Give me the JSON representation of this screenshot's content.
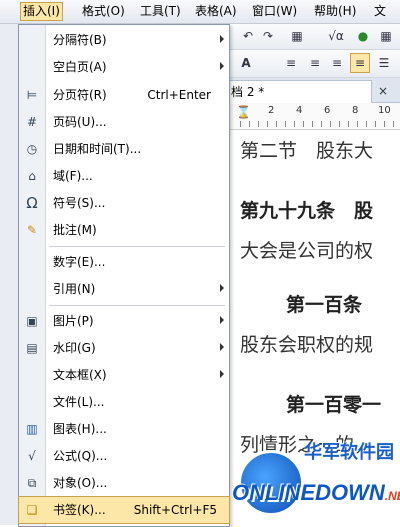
{
  "menubar": {
    "items": [
      {
        "label": "插入(I)",
        "active": true
      },
      {
        "label": "格式(O)"
      },
      {
        "label": "工具(T)"
      },
      {
        "label": "表格(A)"
      },
      {
        "label": "窗口(W)"
      },
      {
        "label": "帮助(H)"
      },
      {
        "label": "文"
      }
    ]
  },
  "toolbar": {
    "undo": "↶",
    "redo": "↷",
    "table": "▦",
    "formula": "√α",
    "font_grow": "A",
    "align_left": "≡",
    "align_center": "≡",
    "align_right": "≡",
    "justify": "≡"
  },
  "doc_tab": {
    "title": "档 2 *",
    "close": "×"
  },
  "ruler": {
    "ticks": [
      "2",
      "4",
      "6",
      "8",
      "10"
    ]
  },
  "document": {
    "lines": [
      "第二节　股东大",
      "第九十九条　股",
      "大会是公司的权",
      "第一百条",
      "股东会职权的规",
      "第一百零一",
      "列情形之一的，"
    ]
  },
  "menu": {
    "items": [
      {
        "label": "分隔符(B)",
        "icon": "",
        "icon_name": "none",
        "shortcut": "",
        "submenu": true
      },
      {
        "label": "空白页(A)",
        "icon": "",
        "icon_name": "none",
        "shortcut": "",
        "submenu": true
      },
      {
        "label": "分页符(R)",
        "icon": "⊨",
        "icon_name": "page-break-icon",
        "shortcut": "Ctrl+Enter",
        "submenu": false
      },
      {
        "label": "页码(U)...",
        "icon": "#",
        "icon_name": "page-number-icon",
        "shortcut": "",
        "submenu": false
      },
      {
        "label": "日期和时间(T)...",
        "icon": "◷",
        "icon_name": "date-time-icon",
        "shortcut": "",
        "submenu": false
      },
      {
        "label": "域(F)...",
        "icon": "⌂",
        "icon_name": "field-icon",
        "shortcut": "",
        "submenu": false
      },
      {
        "label": "符号(S)...",
        "icon": "Ω",
        "icon_name": "omega-symbol-icon",
        "shortcut": "",
        "submenu": false
      },
      {
        "label": "批注(M)",
        "icon": "✎",
        "icon_name": "comment-icon",
        "shortcut": "",
        "submenu": false
      },
      {
        "label": "数字(E)...",
        "icon": "",
        "icon_name": "none",
        "shortcut": "",
        "submenu": false
      },
      {
        "label": "引用(N)",
        "icon": "",
        "icon_name": "none",
        "shortcut": "",
        "submenu": true
      },
      {
        "label": "图片(P)",
        "icon": "▣",
        "icon_name": "picture-icon",
        "shortcut": "",
        "submenu": true
      },
      {
        "label": "水印(G)",
        "icon": "▤",
        "icon_name": "watermark-icon",
        "shortcut": "",
        "submenu": true
      },
      {
        "label": "文本框(X)",
        "icon": "",
        "icon_name": "none",
        "shortcut": "",
        "submenu": true
      },
      {
        "label": "文件(L)...",
        "icon": "",
        "icon_name": "none",
        "shortcut": "",
        "submenu": false
      },
      {
        "label": "图表(H)...",
        "icon": "▥",
        "icon_name": "chart-icon",
        "shortcut": "",
        "submenu": false
      },
      {
        "label": "公式(Q)...",
        "icon": "√",
        "icon_name": "formula-icon",
        "shortcut": "",
        "submenu": false
      },
      {
        "label": "对象(O)...",
        "icon": "⧉",
        "icon_name": "object-icon",
        "shortcut": "",
        "submenu": false
      },
      {
        "label": "书签(K)...",
        "icon": "❏",
        "icon_name": "bookmark-icon",
        "shortcut": "Shift+Ctrl+F5",
        "submenu": false,
        "highlighted": true
      }
    ]
  },
  "watermark": {
    "top": "华军软件园",
    "bottom": "ONLINEDOWN",
    "suffix": ".NET"
  },
  "colors": {
    "highlight": "#fde7a8",
    "menu_border": "#8a98ad",
    "watermark_blue": "#0d57c2"
  }
}
